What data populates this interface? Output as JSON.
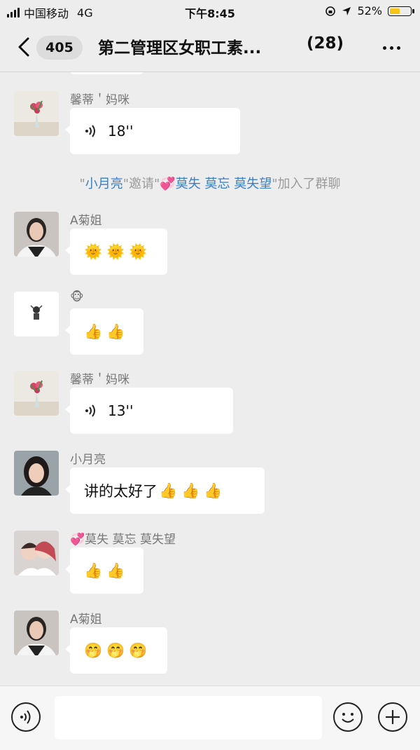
{
  "status_bar": {
    "carrier": "中国移动",
    "network": "4G",
    "time": "下午8:45",
    "battery": "52%",
    "battery_level": 0.52
  },
  "nav": {
    "back_icon": "chevron-left-icon",
    "unread": "405",
    "title": "第二管理区女职工素...",
    "member_count": "(28)",
    "more_icon": "more-dots-icon"
  },
  "messages": [
    {
      "sender": "馨蒂＇妈咪",
      "type": "voice",
      "duration": "18''"
    },
    {
      "sender": "A菊姐",
      "type": "emoji",
      "emoji": [
        "🌞",
        "🌞",
        "🌞"
      ]
    },
    {
      "sender": "🐵",
      "type": "emoji",
      "emoji": [
        "👍",
        "👍"
      ]
    },
    {
      "sender": "馨蒂＇妈咪",
      "type": "voice",
      "duration": "13''"
    },
    {
      "sender": "小月亮",
      "type": "text",
      "text": "讲的太好了",
      "emoji": [
        "👍",
        "👍",
        "👍"
      ]
    },
    {
      "sender": "💞莫失 莫忘 莫失望",
      "type": "emoji",
      "emoji": [
        "👍",
        "👍"
      ]
    },
    {
      "sender": "A菊姐",
      "type": "emoji",
      "emoji": [
        "🤭",
        "🤭",
        "🤭"
      ]
    }
  ],
  "system_notice": {
    "q1": "\"",
    "inviter": "小月亮",
    "mid": "\"邀请\"",
    "invitees": "💞莫失 莫忘 莫失望",
    "end": "\"加入了群聊"
  },
  "input_bar": {
    "voice_icon": "voice-toggle-icon",
    "emoji_icon": "smiley-icon",
    "plus_icon": "plus-icon",
    "placeholder": ""
  },
  "colors": {
    "background": "#ededed",
    "bubble": "#ffffff",
    "link": "#3a7ec6",
    "battery": "#f5c518"
  }
}
